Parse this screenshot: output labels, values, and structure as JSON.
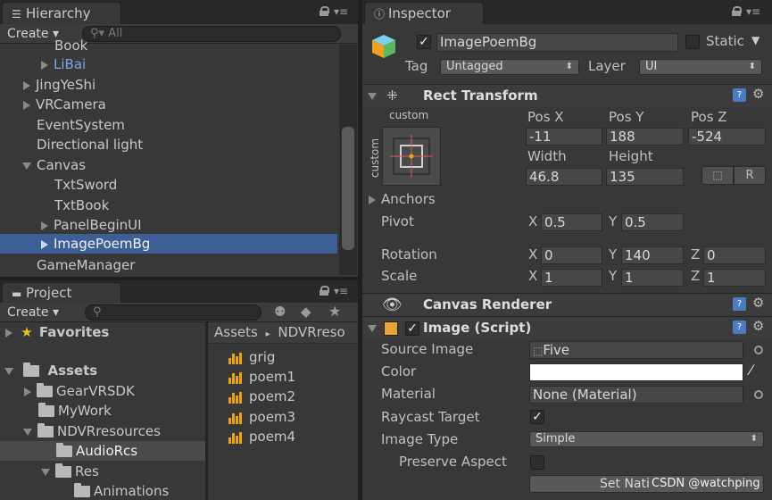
{
  "hierarchy": {
    "tab_label": "Hierarchy",
    "create_label": "Create",
    "search_placeholder": "All",
    "items": [
      {
        "label": "Book"
      },
      {
        "label": "LiBai"
      },
      {
        "label": "JingYeShi"
      },
      {
        "label": "VRCamera"
      },
      {
        "label": "EventSystem"
      },
      {
        "label": "Directional light"
      },
      {
        "label": "Canvas"
      },
      {
        "label": "TxtSword"
      },
      {
        "label": "TxtBook"
      },
      {
        "label": "PanelBeginUI"
      },
      {
        "label": "ImagePoemBg"
      },
      {
        "label": "GameManager"
      }
    ]
  },
  "project": {
    "tab_label": "Project",
    "create_label": "Create",
    "favorites_label": "Favorites",
    "assets_label": "Assets",
    "tree": [
      {
        "label": "GearVRSDK"
      },
      {
        "label": "MyWork"
      },
      {
        "label": "NDVRresources"
      },
      {
        "label": "AudioRcs"
      },
      {
        "label": "Res"
      },
      {
        "label": "Animations"
      }
    ],
    "breadcrumb": [
      "Assets",
      "NDVRreso"
    ],
    "files": [
      {
        "label": "grig"
      },
      {
        "label": "poem1"
      },
      {
        "label": "poem2"
      },
      {
        "label": "poem3"
      },
      {
        "label": "poem4"
      }
    ]
  },
  "inspector": {
    "tab_label": "Inspector",
    "object_name": "ImagePoemBg",
    "static_label": "Static",
    "tag_label": "Tag",
    "tag_value": "Untagged",
    "layer_label": "Layer",
    "layer_value": "UI",
    "rect_transform": {
      "title": "Rect Transform",
      "anchor_preset_top": "custom",
      "anchor_preset_side": "custom",
      "pos_x_label": "Pos X",
      "pos_x": "-11",
      "pos_y_label": "Pos Y",
      "pos_y": "188",
      "pos_z_label": "Pos Z",
      "pos_z": "-524",
      "width_label": "Width",
      "width": "46.8",
      "height_label": "Height",
      "height": "135",
      "r_button": "R",
      "anchors_label": "Anchors",
      "pivot_label": "Pivot",
      "pivot_x_label": "X",
      "pivot_x": "0.5",
      "pivot_y_label": "Y",
      "pivot_y": "0.5",
      "rotation_label": "Rotation",
      "rot_x_label": "X",
      "rot_x": "0",
      "rot_y_label": "Y",
      "rot_y": "140",
      "rot_z_label": "Z",
      "rot_z": "0",
      "scale_label": "Scale",
      "scale_x_label": "X",
      "scale_x": "1",
      "scale_y_label": "Y",
      "scale_y": "1",
      "scale_z_label": "Z",
      "scale_z": "1"
    },
    "canvas_renderer": {
      "title": "Canvas Renderer"
    },
    "image": {
      "title": "Image (Script)",
      "source_image_label": "Source Image",
      "source_image_value": "Five",
      "color_label": "Color",
      "color_value": "#ffffff",
      "material_label": "Material",
      "material_value": "None (Material)",
      "raycast_label": "Raycast Target",
      "image_type_label": "Image Type",
      "image_type_value": "Simple",
      "preserve_aspect_label": "Preserve Aspect",
      "set_native_label": "Set Nati"
    }
  },
  "watermark": "CSDN @watchping",
  "colors": {
    "selection": "#3e5f96",
    "libai_text": "#7ea4ea",
    "audio_icon": "#e9a21a",
    "help_icon": "#4d7bc0"
  }
}
